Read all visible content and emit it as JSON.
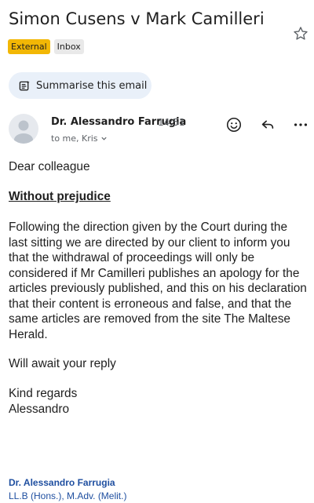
{
  "email": {
    "subject": "Simon Cusens v Mark Camilleri",
    "labels": [
      "External",
      "Inbox"
    ],
    "summarise_label": "Summarise this email",
    "sender": "Dr. Alessandro Farrugia",
    "time": "14:51",
    "recipients": "to me, Kris",
    "body": {
      "greeting": "Dear colleague",
      "heading": "Without prejudice",
      "paragraph": "Following the direction given by the Court during the last  sitting we are directed by our client to inform you that the withdrawal of proceedings will only be considered if Mr Camilleri publishes an apology for the articles previously published, and this on his declaration that their content is erroneous and false, and that the same articles are removed from the site The Maltese Herald.",
      "await_reply": "Will await your reply",
      "regards": "Kind regards",
      "sign_off": "Alessandro"
    },
    "signature": {
      "name": "Dr. Alessandro Farrugia",
      "qualifications": "LL.B (Hons.), M.Adv. (Melit.)"
    }
  },
  "colors": {
    "external_label": "#f2b705",
    "inbox_label": "#e9e9e9",
    "summarise_bg": "#e9f0f9",
    "signature_text": "#1f4fa0"
  },
  "icons": [
    "star-icon",
    "summarise-icon",
    "avatar-person-icon",
    "chevron-down-icon",
    "emoji-react-icon",
    "reply-icon",
    "more-options-icon"
  ]
}
